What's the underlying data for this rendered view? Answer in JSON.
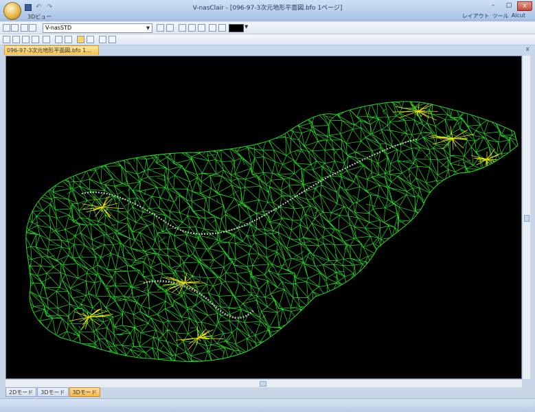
{
  "window": {
    "title": "V-nasClair - [096-97-3次元地形平面図.bfo 1ページ]",
    "controls": {
      "minimize": "–",
      "maximize": "□",
      "close": "x"
    }
  },
  "quick_access": {
    "undo": "↶",
    "redo": "↷"
  },
  "ribbon": {
    "view_label": "3Dビュー",
    "right_menu": [
      "レイアウト",
      "ツール",
      "Alcut"
    ]
  },
  "toolbar": {
    "style_combo_value": "V-nasSTD"
  },
  "document": {
    "tab_label": "096-97-3次元地形平面図.bfo 1...",
    "tab_close": "x"
  },
  "mode_tabs": [
    "2Dモード",
    "3Dモード",
    "3Dモード"
  ],
  "active_mode_index": 2,
  "colors": {
    "mesh_green": "#22dd22",
    "mesh_yellow": "#f2e600",
    "canvas_bg": "#000000",
    "accent_tab": "#f6c04a"
  }
}
